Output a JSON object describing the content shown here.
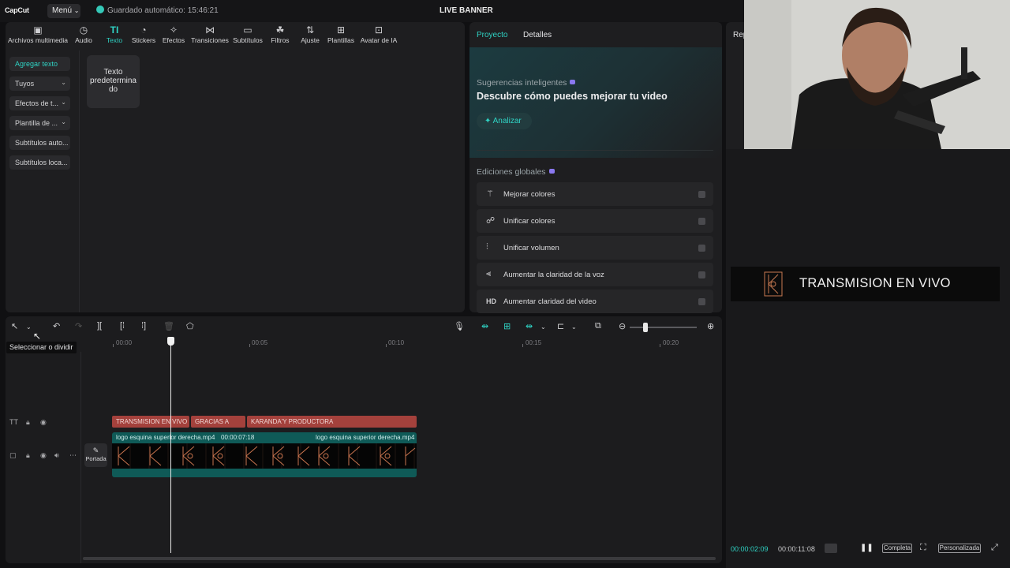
{
  "app": {
    "logo": "CapCut",
    "menu": "Menú",
    "autosave": "Guardado automático: 15:46:21",
    "title": "LIVE BANNER"
  },
  "tools": [
    {
      "label": "Archivos multimedia",
      "icon": "media-icon"
    },
    {
      "label": "Audio",
      "icon": "audio-icon"
    },
    {
      "label": "Texto",
      "icon": "text-icon"
    },
    {
      "label": "Stickers",
      "icon": "sticker-icon"
    },
    {
      "label": "Efectos",
      "icon": "effects-icon"
    },
    {
      "label": "Transiciones",
      "icon": "transitions-icon"
    },
    {
      "label": "Subtítulos",
      "icon": "subtitles-icon"
    },
    {
      "label": "Filtros",
      "icon": "filters-icon"
    },
    {
      "label": "Ajuste",
      "icon": "adjust-icon"
    },
    {
      "label": "Plantillas",
      "icon": "templates-icon"
    },
    {
      "label": "Avatar de IA",
      "icon": "avatar-icon"
    }
  ],
  "text_menu": [
    "Agregar texto",
    "Tuyos",
    "Efectos de t...",
    "Plantilla de ...",
    "Subtítulos auto...",
    "Subtítulos loca..."
  ],
  "default_text": "Texto predetermina do",
  "right": {
    "tab_project": "Proyecto",
    "tab_details": "Detalles",
    "smart_sub": "Sugerencias inteligentes",
    "smart_title": "Descubre cómo puedes mejorar tu video",
    "analyze": "Analizar",
    "global_title": "Ediciones globales",
    "edits": [
      {
        "label": "Mejorar colores",
        "icon": "magic-wand-icon"
      },
      {
        "label": "Unificar colores",
        "icon": "color-match-icon"
      },
      {
        "label": "Unificar volumen",
        "icon": "volume-sliders-icon"
      },
      {
        "label": "Aumentar la claridad de la voz",
        "icon": "voice-wave-icon"
      },
      {
        "label": "Aumentar claridad del video",
        "icon": "hd-icon"
      }
    ]
  },
  "rep_tab": "Rep",
  "player": {
    "banner_text": "TRANSMISION EN VIVO",
    "time_current": "00:00:02:09",
    "time_total": "00:00:11:08",
    "btn_full": "Completa",
    "btn_custom": "Personalizada"
  },
  "timeline": {
    "tooltip": "Seleccionar o dividir",
    "ruler": [
      "00:00",
      "00:05",
      "00:10",
      "00:15",
      "00:20"
    ],
    "text_clips": [
      "TRANSMISION EN VIVO",
      "GRACIAS A",
      "KARANDA'Y PRODUCTORA"
    ],
    "video_clip_1": "logo esquina superior derecha.mp4",
    "video_clip_1_duration": "00:00:07:18",
    "video_clip_2": "logo esquina superior derecha.mp4",
    "cover": "Portada"
  },
  "colors": {
    "accent": "#2fd3c4",
    "text_clip": "#a4413c",
    "video_clip": "#0f5a57"
  }
}
